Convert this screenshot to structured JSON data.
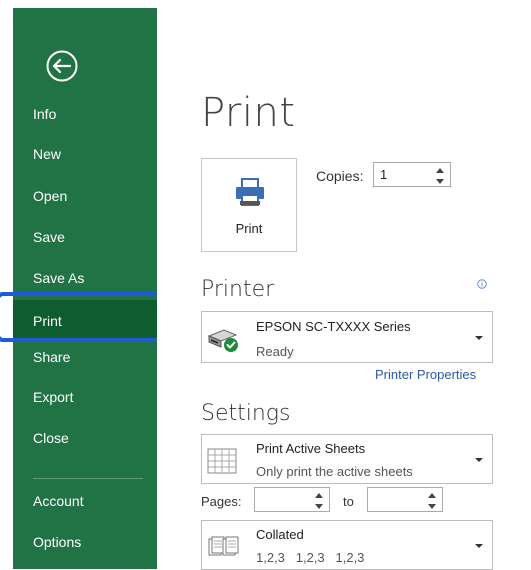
{
  "sidebar": {
    "back_icon": "back-arrow-circle-icon",
    "items": [
      {
        "label": "Info"
      },
      {
        "label": "New"
      },
      {
        "label": "Open"
      },
      {
        "label": "Save"
      },
      {
        "label": "Save As"
      },
      {
        "label": "Print",
        "selected": true
      },
      {
        "label": "Share"
      },
      {
        "label": "Export"
      },
      {
        "label": "Close"
      },
      {
        "label": "Account"
      },
      {
        "label": "Options"
      }
    ]
  },
  "main": {
    "title": "Print",
    "print_button": {
      "label": "Print",
      "icon": "printer-icon"
    },
    "copies": {
      "label": "Copies:",
      "value": "1"
    },
    "printer": {
      "section_title": "Printer",
      "name": "EPSON SC-TXXXX Series",
      "status": "Ready",
      "icon": "printer-ready-icon",
      "properties_link": "Printer Properties"
    },
    "settings": {
      "section_title": "Settings",
      "scope": {
        "title": "Print Active Sheets",
        "subtitle": "Only print the active sheets"
      },
      "pages": {
        "label": "Pages:",
        "from": "",
        "to_label": "to",
        "to": ""
      },
      "collation": {
        "title": "Collated",
        "subtitle": "1,2,3   1,2,3   1,2,3"
      }
    }
  },
  "colors": {
    "sidebar_bg": "#217346",
    "sidebar_selected": "#0e5c2f",
    "selection_outline": "#1f5bd6",
    "link": "#2f5aa8"
  }
}
